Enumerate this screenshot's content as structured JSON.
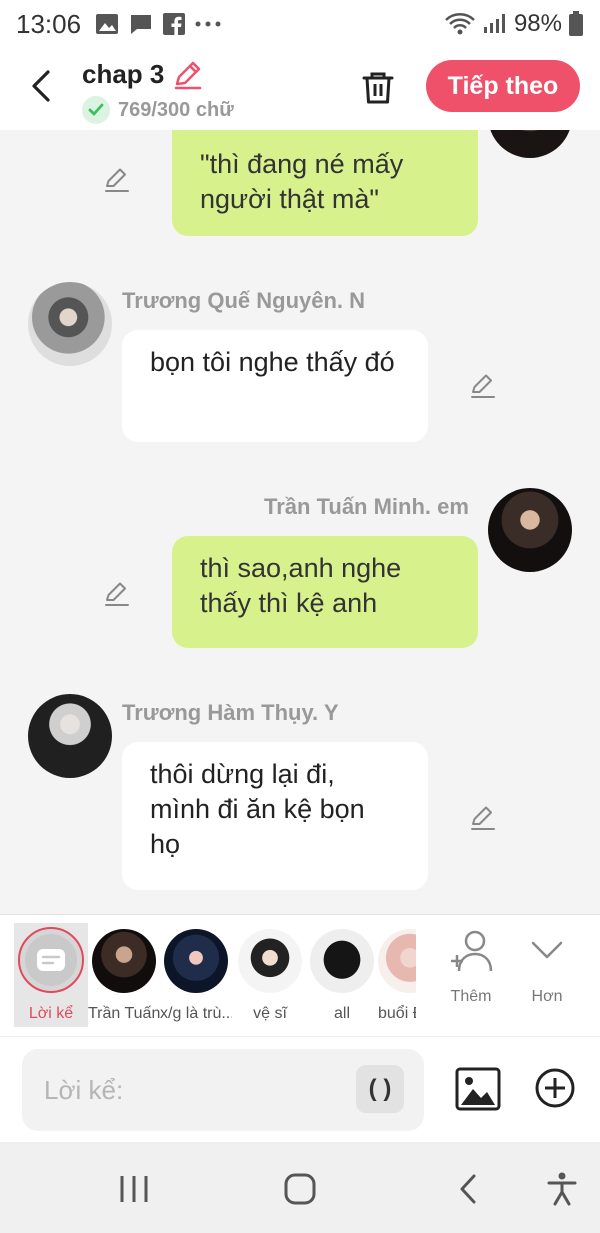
{
  "status_bar": {
    "time": "13:06",
    "battery": "98%"
  },
  "header": {
    "title": "chap 3",
    "word_count": "769/300 chữ",
    "next_label": "Tiếp theo"
  },
  "messages": [
    {
      "side": "right",
      "text": "\"thì đang né mấy người thật mà\""
    },
    {
      "side": "left",
      "sender": "Trương Quế Nguyên. N",
      "text": "bọn tôi nghe thấy đó"
    },
    {
      "side": "right",
      "sender": "Trần Tuấn Minh. em",
      "text": "thì sao,anh nghe thấy thì kệ anh"
    },
    {
      "side": "left",
      "sender": "Trương Hàm Thụy. Y",
      "text": "thôi dừng lại đi, mình đi ăn kệ bọn họ"
    }
  ],
  "characters": {
    "narrator_label": "Lời kể",
    "items": [
      {
        "label": "Trần Tuấn"
      },
      {
        "label": "x/g là trù..."
      },
      {
        "label": "vệ sĩ"
      },
      {
        "label": "all"
      },
      {
        "label": "buổi Đ"
      }
    ],
    "add_label": "Thêm",
    "more_label": "Hơn"
  },
  "input": {
    "placeholder": "Lời kể:",
    "paren_label": "( )"
  },
  "colors": {
    "accent": "#f0516a",
    "my_bubble": "#d7f18d",
    "other_bubble": "#ffffff",
    "check_green": "#3cc05a"
  }
}
